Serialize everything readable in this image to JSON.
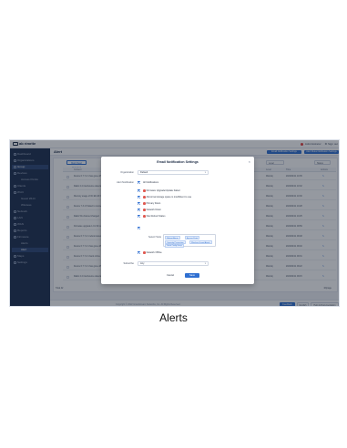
{
  "caption": "Alerts",
  "app": {
    "logo_text": "ab rimrite",
    "user": "Administrator",
    "sign_out": "Sign out"
  },
  "sidebar": {
    "items": [
      {
        "label": "Dashboard",
        "active": false,
        "sub": false
      },
      {
        "label": "Organizations",
        "active": false,
        "sub": false
      },
      {
        "label": "Group",
        "active": true,
        "sub": false
      },
      {
        "label": "Devices",
        "active": false,
        "sub": false
      },
      {
        "label": "Access Points",
        "active": false,
        "sub": true
      },
      {
        "label": "Clients",
        "active": false,
        "sub": false
      },
      {
        "label": "Wi-Fi",
        "active": false,
        "sub": false
      },
      {
        "label": "Guest Wi-Fi",
        "active": false,
        "sub": true
      },
      {
        "label": "Wireless",
        "active": false,
        "sub": true
      },
      {
        "label": "Network",
        "active": false,
        "sub": false
      },
      {
        "label": "LAN",
        "active": false,
        "sub": false
      },
      {
        "label": "WAN",
        "active": false,
        "sub": false
      },
      {
        "label": "Reports",
        "active": false,
        "sub": false
      },
      {
        "label": "Firmware",
        "active": false,
        "sub": false
      },
      {
        "label": "Alerts",
        "active": false,
        "sub": true
      },
      {
        "label": "Alert",
        "active": true,
        "sub": true
      },
      {
        "label": "Maps",
        "active": false,
        "sub": false
      },
      {
        "label": "Settings",
        "active": false,
        "sub": false
      }
    ]
  },
  "page": {
    "title": "Alert",
    "btn_email": "Email Notification Settings",
    "btn_rules": "Alert Rules Notification Settings"
  },
  "table": {
    "add_button": "Mark Read Selected",
    "filters": [
      "Level",
      "Status"
    ],
    "headers": [
      "Content",
      "Level",
      "Time",
      "Actions"
    ],
    "rows": [
      {
        "content": "Device 6.7.7.2.1 has gone offline",
        "level": "Warning",
        "time": "2022/04/11 10:35"
      },
      {
        "content": "Radio 2.4 interference detected",
        "level": "Warning",
        "time": "2022/04/11 10:32"
      },
      {
        "content": "Memory usage of 0C:EF:AF:CD:08:92 ...",
        "level": "Warning",
        "time": "2022/04/11 10:30"
      },
      {
        "content": "Device 7.3.1.5 failed to connect",
        "level": "Warning",
        "time": "2022/04/11 10:28"
      },
      {
        "content": "Radio 5G channel changed",
        "level": "Warning",
        "time": "2022/04/11 10:25"
      },
      {
        "content": "Firmware upgrade 1.0.1.52 completed",
        "level": "Warning",
        "time": "2022/04/11 09:59"
      },
      {
        "content": "Device 6.7.7.2.1 reboot detected",
        "level": "Warning",
        "time": "2022/04/11 09:48"
      },
      {
        "content": "Device 6.7.7.2.1 has gone offline",
        "level": "Warning",
        "time": "2022/04/11 09:40"
      },
      {
        "content": "Device 6.7.7.2.1 back online",
        "level": "Warning",
        "time": "2022/04/11 09:31"
      },
      {
        "content": "Device 6.7.7.2.1 has gone offline",
        "level": "Warning",
        "time": "2022/04/11 09:22"
      },
      {
        "content": "Radio 2.4 interference detected",
        "level": "Warning",
        "time": "2022/04/11 09:15"
      }
    ],
    "total": "Total 42",
    "page_size": "10/page"
  },
  "footer": {
    "text": "Copyright © 2022 Grandstream Networks, Inc. All Rights Reserved.",
    "btn_feedback": "Feedback",
    "btn_english": "English",
    "btn_help": "Help & Documentation"
  },
  "modal": {
    "title": "Email Notification Settings",
    "org_label": "Organization",
    "org_value": "Default",
    "notif_label": "Alert Notification",
    "notif_all": "All Notifications",
    "options": [
      "Firmware Upgrade/Update Failed",
      "Abnormal storage space is insufficient to use",
      "Primary Down",
      "Network Down",
      "Site Reboot Status"
    ],
    "select_label": "Select Hosts",
    "tags": [
      "Reboot Alarm",
      "Access Point",
      "Capacity Prevention",
      "Wireless Guard Attack",
      "Guest Config Group"
    ],
    "last_option": "Network Offline",
    "sub_label": "Subscribe",
    "sub_value": "Any",
    "cancel": "Cancel",
    "save": "Save",
    "close": "×"
  }
}
